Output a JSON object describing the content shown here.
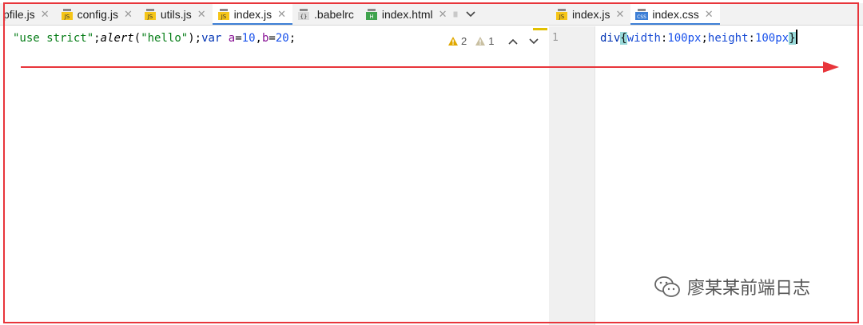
{
  "left_tabs": [
    {
      "label": "pfile.js",
      "icon": "js-file-icon"
    },
    {
      "label": "config.js",
      "icon": "js-file-icon"
    },
    {
      "label": "utils.js",
      "icon": "js-file-icon"
    },
    {
      "label": "index.js",
      "icon": "js-file-icon",
      "active": true
    },
    {
      "label": ".babelrc",
      "icon": "babelrc-file-icon"
    },
    {
      "label": "index.html",
      "icon": "html-file-icon"
    }
  ],
  "right_tabs": [
    {
      "label": "index.js",
      "icon": "js-file-icon"
    },
    {
      "label": "index.css",
      "icon": "css-file-icon",
      "active": true
    }
  ],
  "icon_text": {
    "js": "JS",
    "css": "CSS",
    "html": "H",
    "babelrc": "{}"
  },
  "left_editor": {
    "code": {
      "str1": "\"use strict\"",
      "semi1": ";",
      "fn": "alert",
      "paren_open": "(",
      "str2": "\"hello\"",
      "paren_close": ");",
      "kw_var": "var",
      "var_a": " a",
      "eq1": "=",
      "num1": "10",
      "comma": ",",
      "var_b": "b",
      "eq2": "=",
      "num2": "20",
      "semi2": ";"
    },
    "inspections": {
      "warnings": "2",
      "weak_warnings": "1"
    }
  },
  "right_editor": {
    "line_number": "1",
    "code": {
      "selector": "div",
      "brace_open": "{",
      "prop1": "width",
      "colon1": ":",
      "val1": "100px",
      "semi": ";",
      "prop2": "height",
      "colon2": ":",
      "val2": "100px",
      "brace_close": "}"
    }
  },
  "watermark": {
    "text": "廖某某前端日志"
  },
  "colors": {
    "annotation_red": "#e8353b",
    "active_tab_underline": "#3d7fd6"
  }
}
